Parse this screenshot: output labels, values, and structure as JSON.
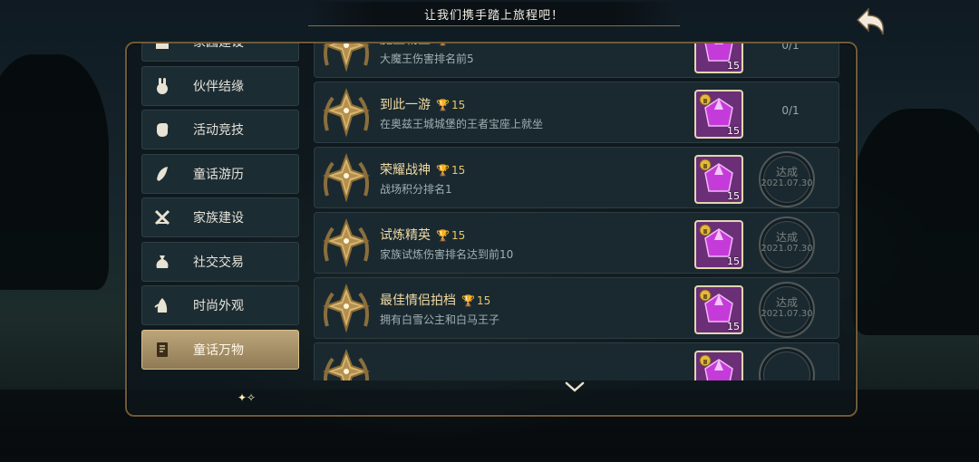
{
  "banner": {
    "text": "让我们携手踏上旅程吧！"
  },
  "sidebar": {
    "items": [
      {
        "label": "家园建设",
        "icon": "house-icon",
        "active": false
      },
      {
        "label": "伙伴结缘",
        "icon": "rabbit-icon",
        "active": false
      },
      {
        "label": "活动竞技",
        "icon": "fist-icon",
        "active": false
      },
      {
        "label": "童话游历",
        "icon": "feather-icon",
        "active": false
      },
      {
        "label": "家族建设",
        "icon": "crossed-swords-icon",
        "active": false
      },
      {
        "label": "社交交易",
        "icon": "money-bag-icon",
        "active": false
      },
      {
        "label": "时尚外观",
        "icon": "fashion-icon",
        "active": false
      },
      {
        "label": "童话万物",
        "icon": "book-icon",
        "active": true
      }
    ]
  },
  "achievements": [
    {
      "title": "魔王霸王",
      "points": "15",
      "desc": "大魔王伤害排名前5",
      "reward_qty": "15",
      "status": "progress",
      "progress": "0/1"
    },
    {
      "title": "到此一游",
      "points": "15",
      "desc": "在奥兹王城城堡的王者宝座上就坐",
      "reward_qty": "15",
      "status": "progress",
      "progress": "0/1"
    },
    {
      "title": "荣耀战神",
      "points": "15",
      "desc": "战场积分排名1",
      "reward_qty": "15",
      "status": "done",
      "stamp_text": "达成",
      "date": "2021.07.30"
    },
    {
      "title": "试炼精英",
      "points": "15",
      "desc": "家族试炼伤害排名达到前10",
      "reward_qty": "15",
      "status": "done",
      "stamp_text": "达成",
      "date": "2021.07.30"
    },
    {
      "title": "最佳情侣拍档",
      "points": "15",
      "desc": "拥有白雪公主和白马王子",
      "reward_qty": "15",
      "status": "done",
      "stamp_text": "达成",
      "date": "2021.07.30"
    },
    {
      "title": "",
      "points": "",
      "desc": "",
      "reward_qty": "",
      "status": "done",
      "stamp_text": "",
      "date": ""
    }
  ],
  "colors": {
    "gold_title": "#f0d9a3",
    "gem": "#c53bd9",
    "active_tab": "#bca57a"
  }
}
